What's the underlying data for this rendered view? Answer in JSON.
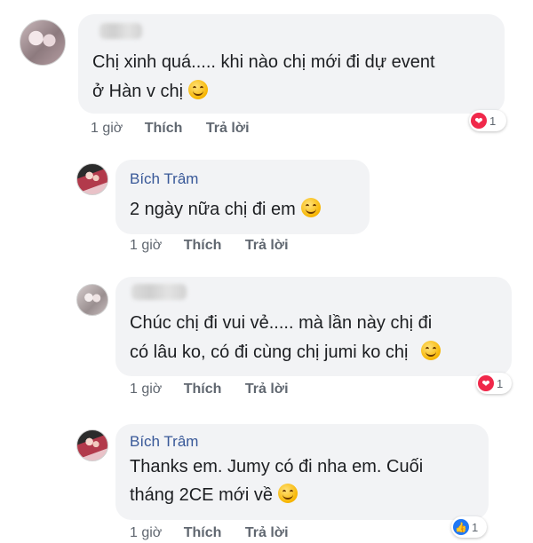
{
  "comments": [
    {
      "author": "",
      "text_lines": [
        "Chị xinh quá..... khi nào chị mới đi dự event",
        "ở Hàn v chị"
      ],
      "emoji": "smile-emoji",
      "time": "1 giờ",
      "like_label": "Thích",
      "reply_label": "Trả lời",
      "reaction": {
        "icon": "heart-icon",
        "count": "1",
        "color": "#f0284a"
      }
    },
    {
      "author": "Bích Trâm",
      "text_lines": [
        "2 ngày nữa chị đi em"
      ],
      "emoji": "smile-emoji",
      "time": "1 giờ",
      "like_label": "Thích",
      "reply_label": "Trả lời"
    },
    {
      "author": "",
      "text_lines": [
        "Chúc chị đi vui vẻ..... mà lần này chị đi",
        "có lâu ko, có đi cùng chị jumi ko chị"
      ],
      "emoji": "smile-emoji",
      "time": "1 giờ",
      "like_label": "Thích",
      "reply_label": "Trả lời",
      "reaction": {
        "icon": "heart-icon",
        "count": "1",
        "color": "#f0284a"
      }
    },
    {
      "author": "Bích Trâm",
      "text_lines": [
        "Thanks em. Jumy có đi nha em. Cuối",
        "tháng 2CE mới về"
      ],
      "emoji": "smile-emoji",
      "time": "1 giờ",
      "like_label": "Thích",
      "reply_label": "Trả lời",
      "reaction": {
        "icon": "thumbs-up-icon",
        "count": "1",
        "color": "#2078f4"
      }
    }
  ],
  "colors": {
    "bubble": "#f2f3f5",
    "author_link": "#385898",
    "meta_text": "#606770"
  }
}
